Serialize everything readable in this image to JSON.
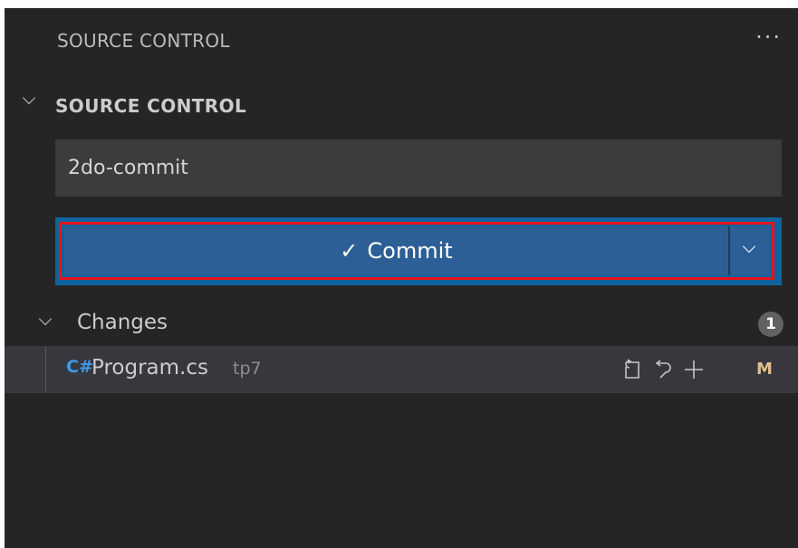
{
  "header": {
    "title": "SOURCE CONTROL",
    "more_actions": "···"
  },
  "section": {
    "title": "SOURCE CONTROL",
    "expanded": true
  },
  "commit_message": {
    "value": "2do-commit"
  },
  "commit_button": {
    "check": "✓",
    "label": "Commit",
    "highlight_color": "#e8121c",
    "color": "#2c5f95"
  },
  "changes": {
    "label": "Changes",
    "count": "1",
    "files": [
      {
        "icon_text": "C#",
        "icon": "csharp-file-icon",
        "name": "Program.cs",
        "folder": "tp7",
        "status": "M",
        "status_color": "#e2c08d",
        "actions": [
          "open-file-icon",
          "discard-changes-icon",
          "stage-changes-icon"
        ]
      }
    ]
  }
}
